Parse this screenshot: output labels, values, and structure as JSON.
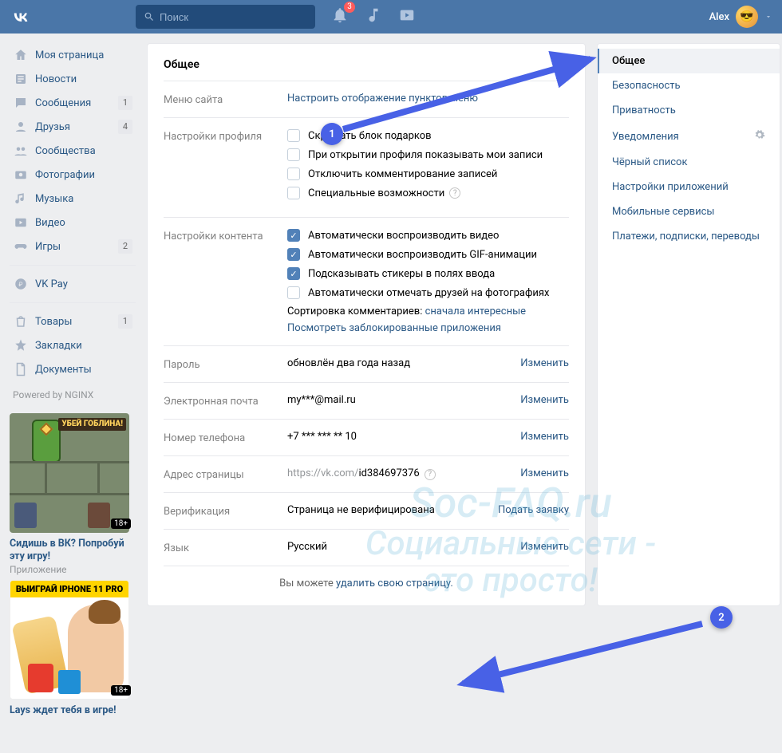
{
  "top": {
    "search_placeholder": "Поиск",
    "notif_count": "3",
    "username": "Alex"
  },
  "sidebar": [
    {
      "label": "Моя страница",
      "icon": "home"
    },
    {
      "label": "Новости",
      "icon": "news"
    },
    {
      "label": "Сообщения",
      "icon": "msg",
      "count": "1"
    },
    {
      "label": "Друзья",
      "icon": "friends",
      "count": "4"
    },
    {
      "label": "Сообщества",
      "icon": "groups"
    },
    {
      "label": "Фотографии",
      "icon": "photo"
    },
    {
      "label": "Музыка",
      "icon": "music"
    },
    {
      "label": "Видео",
      "icon": "video"
    },
    {
      "label": "Игры",
      "icon": "games",
      "count": "2"
    }
  ],
  "sidebar2": [
    {
      "label": "VK Pay",
      "icon": "pay"
    }
  ],
  "sidebar3": [
    {
      "label": "Товары",
      "icon": "market",
      "count": "1"
    },
    {
      "label": "Закладки",
      "icon": "fav"
    },
    {
      "label": "Документы",
      "icon": "docs"
    }
  ],
  "powered": "Powered by NGINX",
  "ads": [
    {
      "banner": "УБЕЙ ГОБЛИНА!",
      "title": "Сидишь в ВК? Попробуй эту игру!",
      "sub": "Приложение",
      "badge": "18+"
    },
    {
      "banner": "ВЫИГРАЙ IPHONE 11 PRO",
      "title": "Lays ждет тебя в игре!",
      "sub": "",
      "badge": "18+"
    }
  ],
  "settings": {
    "heading": "Общее",
    "menu_label": "Меню сайта",
    "menu_link": "Настроить отображение пунктов меню",
    "profile_label": "Настройки профиля",
    "profile_checks": [
      {
        "label": "Скрывать блок подарков",
        "checked": false
      },
      {
        "label": "При открытии профиля показывать мои записи",
        "checked": false
      },
      {
        "label": "Отключить комментирование записей",
        "checked": false
      },
      {
        "label": "Специальные возможности",
        "checked": false,
        "help": true
      }
    ],
    "content_label": "Настройки контента",
    "content_checks": [
      {
        "label": "Автоматически воспроизводить видео",
        "checked": true
      },
      {
        "label": "Автоматически воспроизводить GIF-анимации",
        "checked": true
      },
      {
        "label": "Подсказывать стикеры в полях ввода",
        "checked": true
      },
      {
        "label": "Автоматически отмечать друзей на фотографиях",
        "checked": false
      }
    ],
    "sort_label": "Сортировка комментариев: ",
    "sort_value": "сначала интересные",
    "blocked_apps": "Посмотреть заблокированные приложения",
    "fields": [
      {
        "label": "Пароль",
        "value": "обновлён два года назад",
        "action": "Изменить"
      },
      {
        "label": "Электронная почта",
        "value": "my***@mail.ru",
        "action": "Изменить"
      },
      {
        "label": "Номер телефона",
        "value": "+7 *** *** ** 10",
        "action": "Изменить"
      },
      {
        "label": "Адрес страницы",
        "value": "https://vk.com/id384697376",
        "action": "Изменить",
        "help": true,
        "muted_prefix": "https://vk.com/",
        "suffix": "id384697376"
      },
      {
        "label": "Верификация",
        "value": "Страница не верифицирована",
        "action": "Подать заявку"
      },
      {
        "label": "Язык",
        "value": "Русский",
        "action": "Изменить"
      }
    ],
    "footer_pre": "Вы можете ",
    "footer_link": "удалить свою страницу."
  },
  "rightnav": [
    {
      "label": "Общее",
      "active": true
    },
    {
      "label": "Безопасность"
    },
    {
      "label": "Приватность"
    },
    {
      "label": "Уведомления",
      "gear": true
    },
    {
      "label": "Чёрный список"
    },
    {
      "label": "Настройки приложений"
    },
    {
      "label": "Мобильные сервисы"
    },
    {
      "label": "Платежи, подписки, переводы"
    }
  ],
  "markers": {
    "m1": "1",
    "m2": "2"
  },
  "watermark": {
    "l1": "Soc-FAQ.ru",
    "l2": "Социальные сети -",
    "l3": "это просто!"
  }
}
